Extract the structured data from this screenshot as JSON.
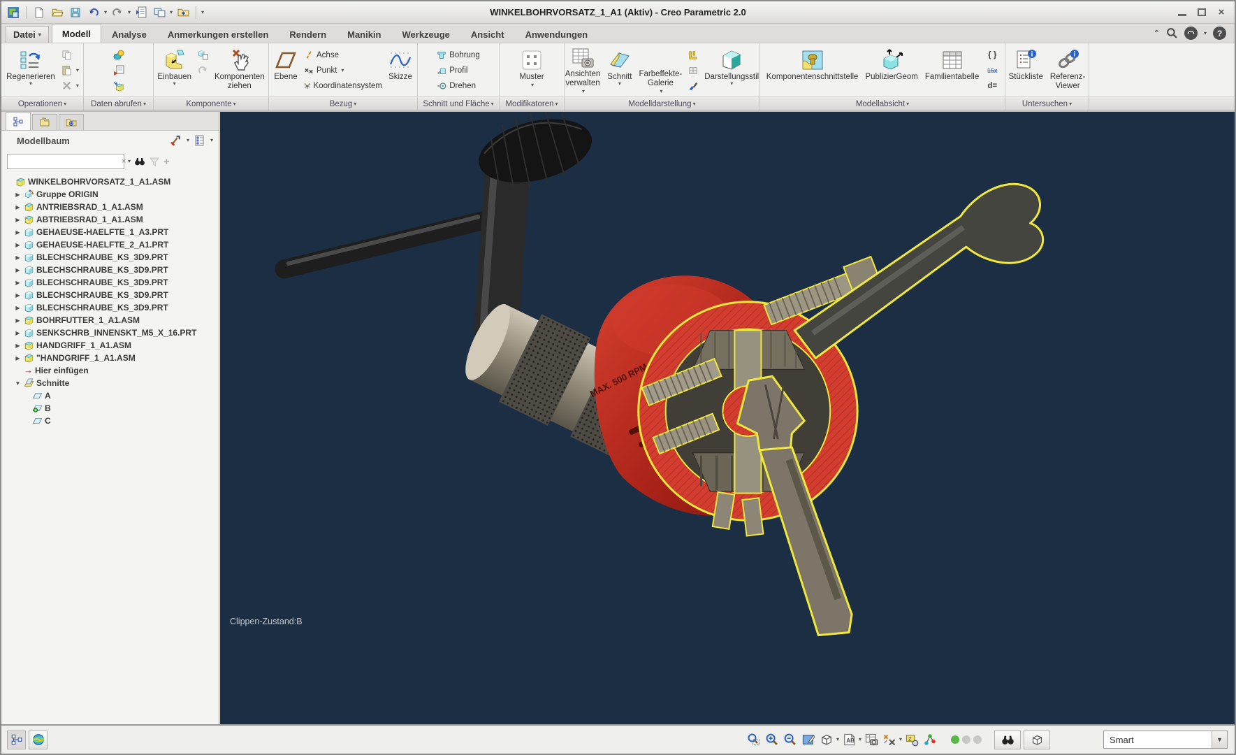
{
  "window": {
    "title": "WINKELBOHRVORSATZ_1_A1 (Aktiv) - Creo Parametric 2.0"
  },
  "menubar": {
    "file_label": "Datei",
    "tabs": [
      "Modell",
      "Analyse",
      "Anmerkungen erstellen",
      "Rendern",
      "Manikin",
      "Werkzeuge",
      "Ansicht",
      "Anwendungen"
    ],
    "active_tab": "Modell"
  },
  "ribbon": {
    "buttons": {
      "regenerieren": "Regenerieren",
      "einbauen": "Einbauen",
      "komponenten_ziehen": "Komponenten\nziehen",
      "ebene": "Ebene",
      "achse": "Achse",
      "punkt": "Punkt",
      "koordinatensystem": "Koordinatensystem",
      "skizze": "Skizze",
      "bohrung": "Bohrung",
      "profil": "Profil",
      "drehen": "Drehen",
      "muster": "Muster",
      "ansichten_verwalten": "Ansichten\nverwalten",
      "schnitt": "Schnitt",
      "farbeffekte_galerie": "Farbeffekte-\nGalerie",
      "darstellungsstil": "Darstellungsstil",
      "komponentenschnittstelle": "Komponentenschnittstelle",
      "publiziergeom": "PublizierGeom",
      "familientabelle": "Familientabelle",
      "stueckliste": "Stückliste",
      "referenz_viewer": "Referenz-\nViewer"
    },
    "group_labels": [
      "Operationen",
      "Daten abrufen",
      "Komponente",
      "Bezug",
      "Schnitt und Fläche",
      "Modifikatoren",
      "Modelldarstellung",
      "Modellabsicht",
      "Untersuchen"
    ]
  },
  "icons": {
    "braces": "{ }",
    "d_equals": "d=",
    "fraction": "15x"
  },
  "model_tree": {
    "title": "Modellbaum",
    "items": [
      {
        "label": "WINKELBOHRVORSATZ_1_A1.ASM",
        "icon": "asm",
        "level": 0,
        "arrow": "none"
      },
      {
        "label": "Gruppe ORIGIN",
        "icon": "group",
        "level": 1,
        "arrow": "right"
      },
      {
        "label": "ANTRIEBSRAD_1_A1.ASM",
        "icon": "asm",
        "level": 1,
        "arrow": "right"
      },
      {
        "label": "ABTRIEBSRAD_1_A1.ASM",
        "icon": "asm",
        "level": 1,
        "arrow": "right"
      },
      {
        "label": "GEHAEUSE-HAELFTE_1_A3.PRT",
        "icon": "prt",
        "level": 1,
        "arrow": "right"
      },
      {
        "label": "GEHAEUSE-HAELFTE_2_A1.PRT",
        "icon": "prt",
        "level": 1,
        "arrow": "right"
      },
      {
        "label": "BLECHSCHRAUBE_KS_3D9.PRT",
        "icon": "prt",
        "level": 1,
        "arrow": "right"
      },
      {
        "label": "BLECHSCHRAUBE_KS_3D9.PRT",
        "icon": "prt",
        "level": 1,
        "arrow": "right"
      },
      {
        "label": "BLECHSCHRAUBE_KS_3D9.PRT",
        "icon": "prt",
        "level": 1,
        "arrow": "right"
      },
      {
        "label": "BLECHSCHRAUBE_KS_3D9.PRT",
        "icon": "prt",
        "level": 1,
        "arrow": "right"
      },
      {
        "label": "BLECHSCHRAUBE_KS_3D9.PRT",
        "icon": "prt",
        "level": 1,
        "arrow": "right"
      },
      {
        "label": "BOHRFUTTER_1_A1.ASM",
        "icon": "asm",
        "level": 1,
        "arrow": "right"
      },
      {
        "label": "SENKSCHRB_INNENSKT_M5_X_16.PRT",
        "icon": "prt",
        "level": 1,
        "arrow": "right"
      },
      {
        "label": "HANDGRIFF_1_A1.ASM",
        "icon": "asm",
        "level": 1,
        "arrow": "right"
      },
      {
        "label": "\"HANDGRIFF_1_A1.ASM",
        "icon": "asm",
        "level": 1,
        "arrow": "right"
      },
      {
        "label": "Hier einfügen",
        "icon": "insert",
        "level": 1,
        "arrow": "none"
      },
      {
        "label": "Schnitte",
        "icon": "sections",
        "level": 1,
        "arrow": "down"
      },
      {
        "label": "A",
        "icon": "plane",
        "level": 2,
        "arrow": "none"
      },
      {
        "label": "B",
        "icon": "plane-active",
        "level": 2,
        "arrow": "none"
      },
      {
        "label": "C",
        "icon": "plane",
        "level": 2,
        "arrow": "none"
      }
    ]
  },
  "viewport": {
    "clip_state_label": "Clippen-Zustand:B",
    "engraving": "MAX. 500 RPM"
  },
  "status_bar": {
    "filter_value": "Smart"
  },
  "colors": {
    "viewport_bg": "#1c2e44",
    "section_red": "#d23d2f",
    "highlight_yellow": "#f0e83a",
    "status_green": "#57b847"
  }
}
